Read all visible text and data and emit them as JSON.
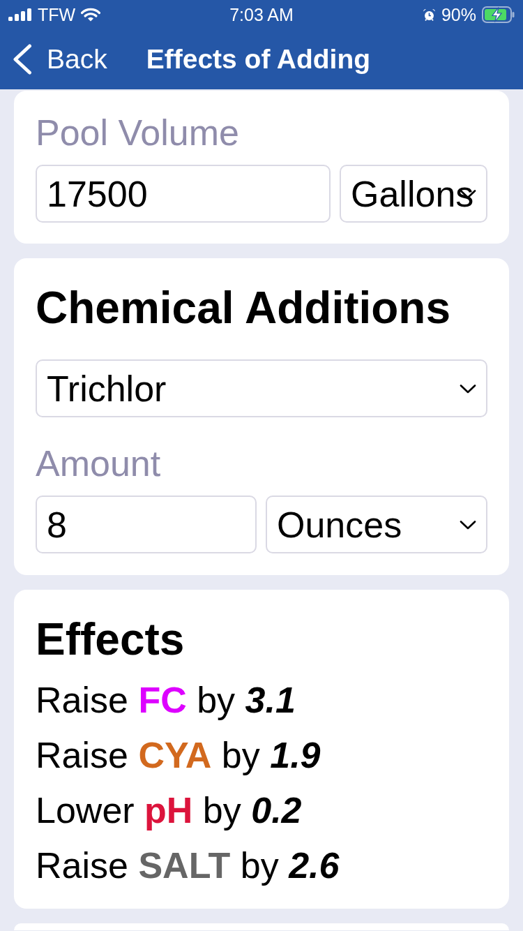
{
  "status_bar": {
    "carrier": "TFW",
    "time": "7:03 AM",
    "battery": "90%"
  },
  "nav_bar": {
    "back": "Back",
    "title": "Effects of Adding"
  },
  "pool_volume": {
    "label": "Pool Volume",
    "value": "17500",
    "unit": "Gallons"
  },
  "chemical_additions": {
    "title": "Chemical Additions",
    "chemical": "Trichlor",
    "amount_label": "Amount",
    "amount": "8",
    "amount_unit": "Ounces"
  },
  "effects": {
    "title": "Effects",
    "items": [
      {
        "verb": "Raise",
        "parameter": "FC",
        "connector": "by",
        "amount": "3.1",
        "color": "#dd00ff"
      },
      {
        "verb": "Raise",
        "parameter": "CYA",
        "connector": "by",
        "amount": "1.9",
        "color": "#d2691e"
      },
      {
        "verb": "Lower",
        "parameter": "pH",
        "connector": "by",
        "amount": "0.2",
        "color": "#dc143c"
      },
      {
        "verb": "Raise",
        "parameter": "SALT",
        "connector": "by",
        "amount": "2.6",
        "color": "#666666"
      }
    ]
  }
}
